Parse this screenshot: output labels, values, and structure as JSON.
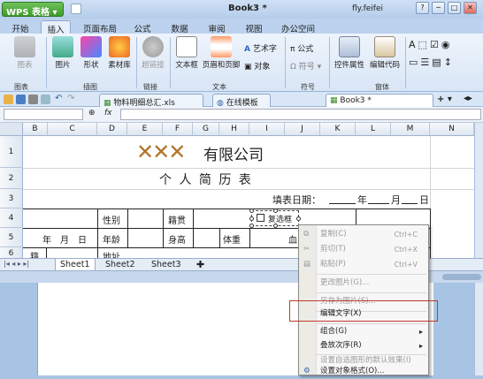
{
  "app": {
    "menu_label": "WPS 表格",
    "window_title": "Book3 *",
    "user": "fly.feifei"
  },
  "window_buttons": [
    "─",
    "□",
    "✕"
  ],
  "tabs": [
    "开始",
    "插入",
    "页面布局",
    "公式",
    "数据",
    "审阅",
    "视图",
    "办公空间"
  ],
  "active_tab": "插入",
  "ribbon": {
    "buttons": [
      {
        "label": "图表",
        "disabled": true
      },
      {
        "label": "图片",
        "disabled": false
      },
      {
        "label": "形状",
        "disabled": false
      },
      {
        "label": "素材库",
        "disabled": false
      },
      {
        "label": "超链接",
        "disabled": true
      },
      {
        "label": "文本框",
        "disabled": false
      },
      {
        "label": "页眉和页脚",
        "disabled": false
      }
    ],
    "small_buttons": {
      "art": "艺术字",
      "obj": "对象",
      "formula": "公式",
      "symbol": "符号",
      "ctrl": "控件属性",
      "code": "编辑代码"
    },
    "groups": {
      "chart": "图表",
      "illust": "插图",
      "link": "链接",
      "text": "文本",
      "symbol": "符号",
      "widget": "窗体"
    }
  },
  "doc_tabs": [
    "物料明细总汇.xls",
    "在线模板",
    "Book3 *"
  ],
  "formula_bar": {
    "fx": "fx"
  },
  "grid": {
    "columns": [
      "B",
      "C",
      "D",
      "E",
      "F",
      "G",
      "H",
      "I",
      "J",
      "K",
      "L",
      "M",
      "N"
    ],
    "rows": [
      "1",
      "2",
      "3",
      "4",
      "5",
      "6"
    ]
  },
  "resume": {
    "logo": "✕✕✕",
    "company": "有限公司",
    "title": "个 人 简 历 表",
    "date_label": "填表日期：",
    "date_year": "年",
    "date_month": "月",
    "date_day": "日",
    "gender": "性别",
    "native": "籍贯",
    "checkbox": "复选框",
    "ymd": "年　月　日",
    "age": "年龄",
    "height": "身高",
    "weight": "体重",
    "blood": "血",
    "ji": "籍",
    "address": "地址"
  },
  "sheets": [
    "Sheet1",
    "Sheet2",
    "Sheet3"
  ],
  "context_menu": [
    {
      "label": "复制(C)",
      "shortcut": "Ctrl+C",
      "disabled": true
    },
    {
      "label": "剪切(T)",
      "shortcut": "Ctrl+X",
      "disabled": true
    },
    {
      "label": "粘贴(P)",
      "shortcut": "Ctrl+V",
      "disabled": true
    },
    {
      "label": "更改图片(G)...",
      "disabled": true
    },
    {
      "label": "另存为图片(S)...",
      "disabled": true
    },
    {
      "label": "编辑文字(X)",
      "disabled": false,
      "highlighted": true
    },
    {
      "label": "组合(G)",
      "submenu": true,
      "disabled": false
    },
    {
      "label": "叠放次序(R)",
      "submenu": true,
      "disabled": false
    },
    {
      "label": "设置自选图形的默认效果(I)",
      "disabled": true
    },
    {
      "label": "设置对象格式(O)...",
      "disabled": false
    }
  ],
  "colors": {
    "accent": "#3f9a2c",
    "logo": "#b0742c",
    "highlight_border": "#c0392b"
  }
}
